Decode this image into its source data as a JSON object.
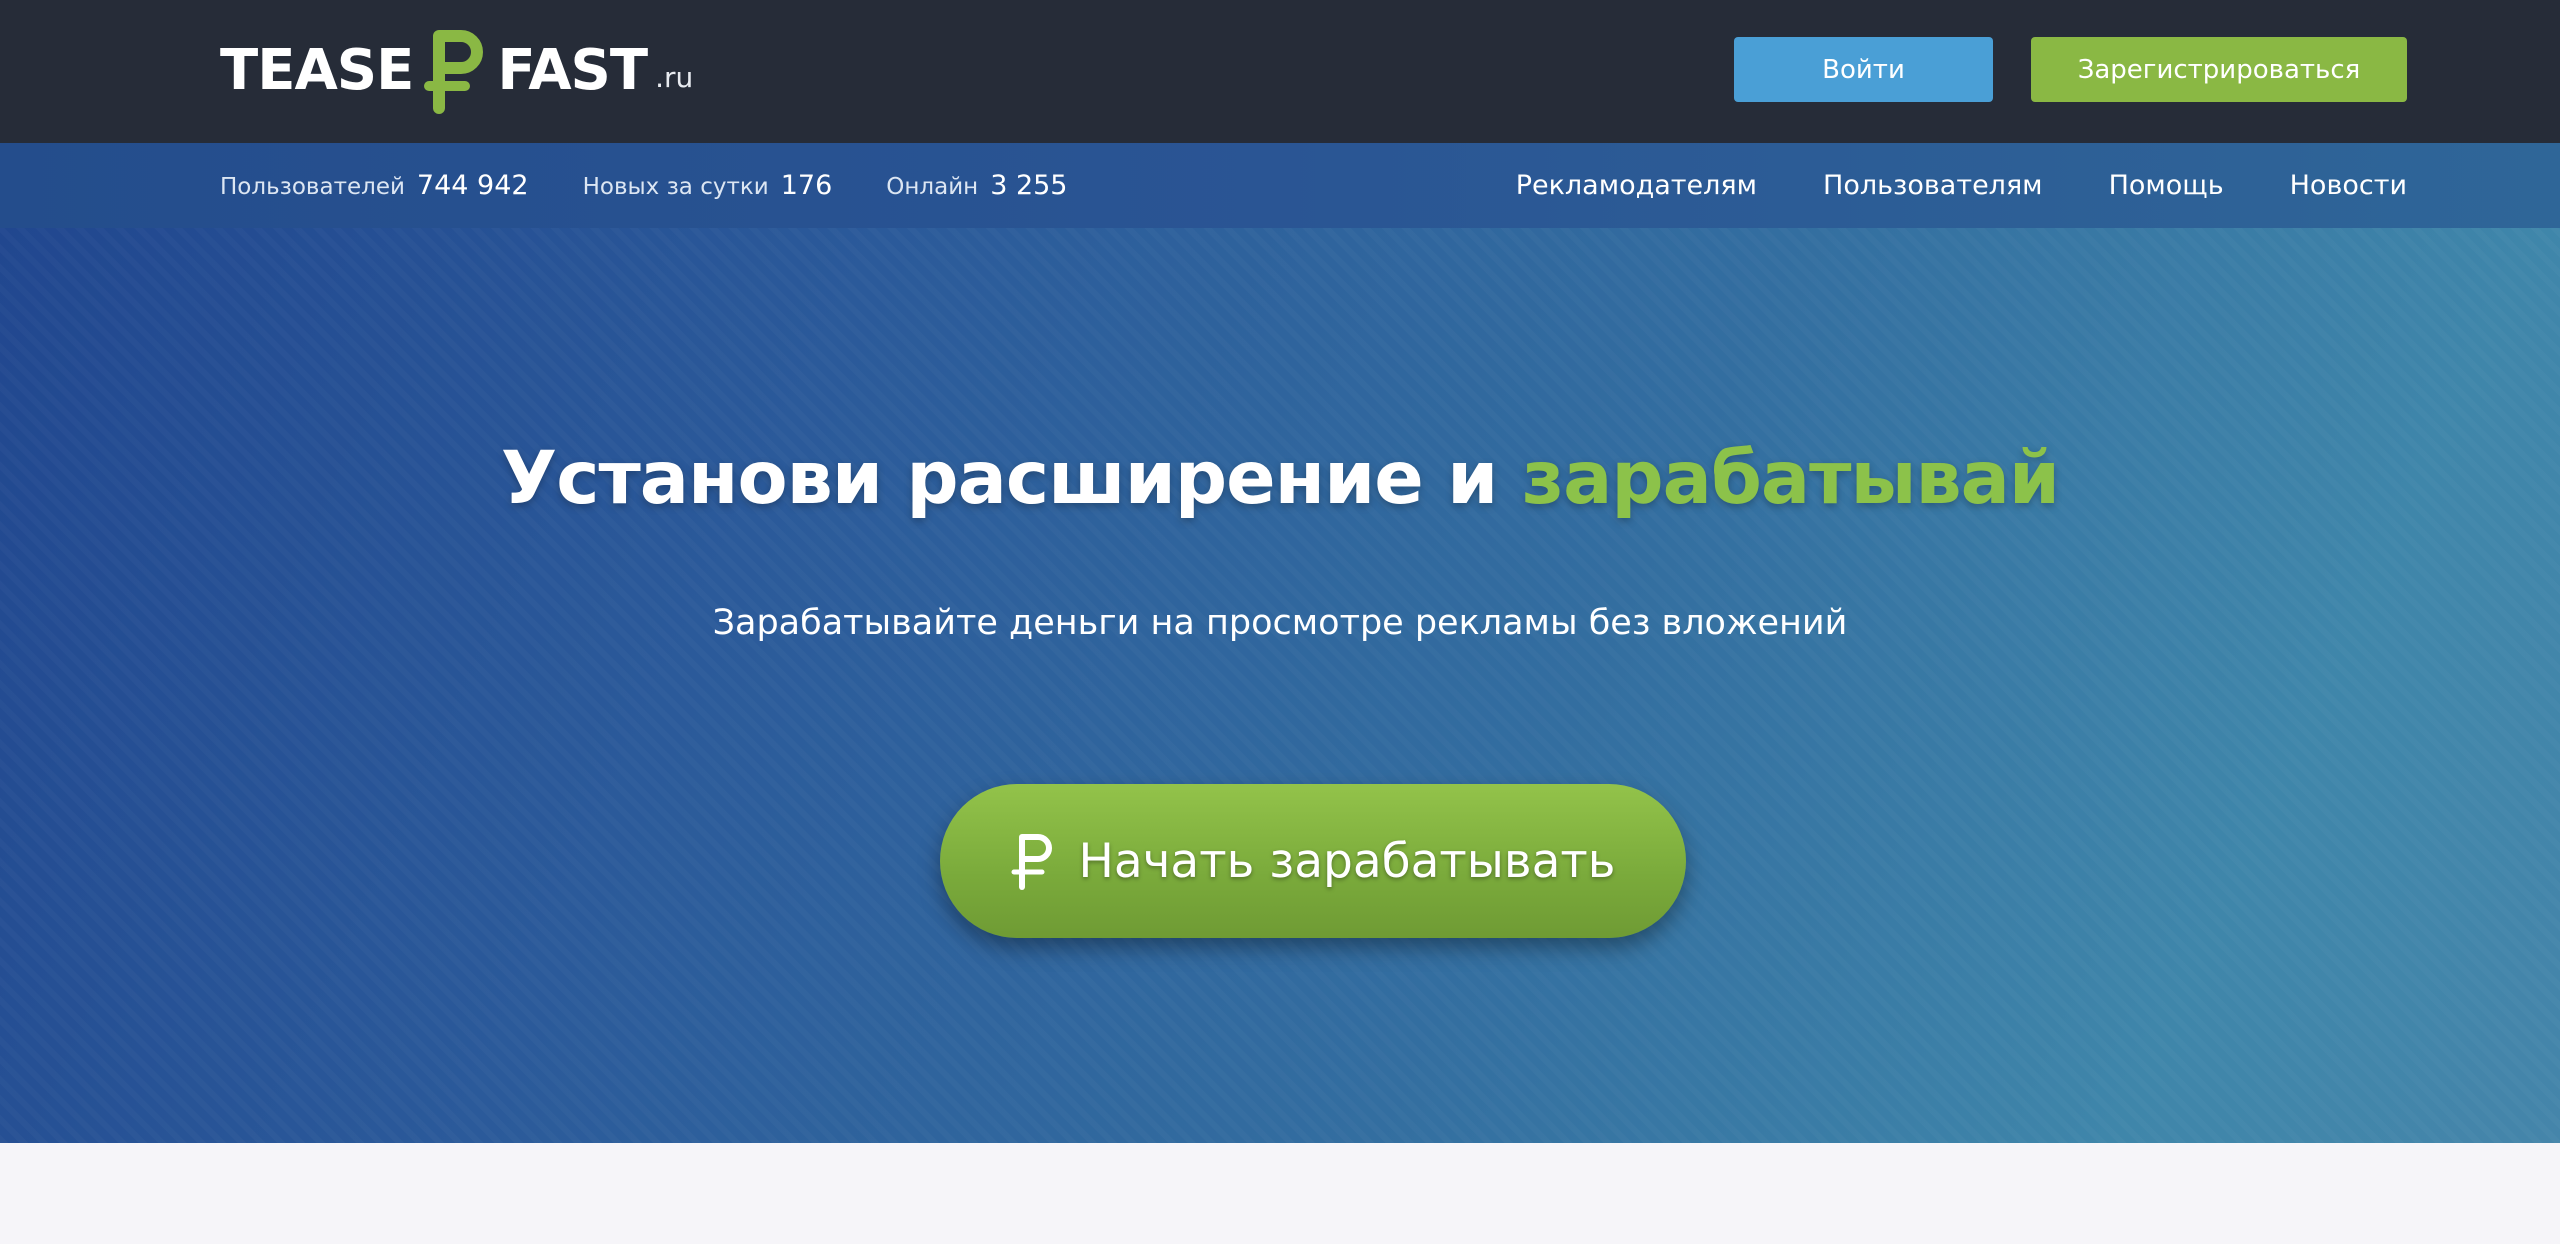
{
  "header": {
    "logo": {
      "left": "TEASE",
      "right": "FAST",
      "tld": ".ru",
      "icon": "ruble-icon",
      "accent_color": "#8ab844"
    },
    "login_label": "Войти",
    "register_label": "Зарегистрироваться",
    "colors": {
      "background": "#262c38",
      "login": "#4a9fd6",
      "register": "#8ab844"
    }
  },
  "stats": [
    {
      "label": "Пользователей",
      "value": "744 942"
    },
    {
      "label": "Новых за сутки",
      "value": "176"
    },
    {
      "label": "Онлайн",
      "value": "3 255"
    }
  ],
  "nav": [
    {
      "label": "Рекламодателям"
    },
    {
      "label": "Пользователям"
    },
    {
      "label": "Помощь"
    },
    {
      "label": "Новости"
    }
  ],
  "hero": {
    "title_main": "Установи расширение и ",
    "title_accent": "зарабатывай",
    "subtitle": "Зарабатывайте деньги на просмотре рекламы без вложений",
    "cta_label": "Начать зарабатывать",
    "cta_icon": "ruble-icon",
    "accent_color": "#8cc24a"
  }
}
